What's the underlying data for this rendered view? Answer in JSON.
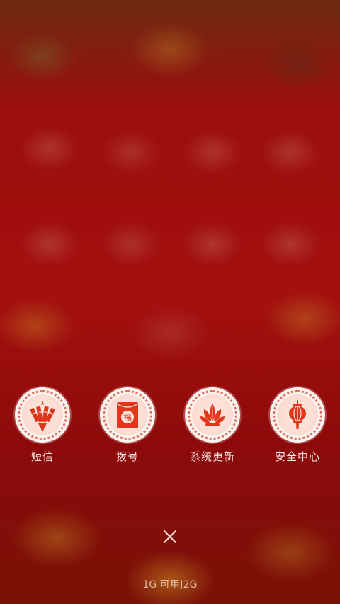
{
  "shortcuts": [
    {
      "label": "短信",
      "icon": "firecracker-icon"
    },
    {
      "label": "拨号",
      "icon": "red-envelope-fu-icon"
    },
    {
      "label": "系统更新",
      "icon": "lotus-icon"
    },
    {
      "label": "安全中心",
      "icon": "lantern-icon"
    }
  ],
  "envelope_char": "福",
  "close": {
    "icon": "close-icon"
  },
  "memory": {
    "available": "1G 可用",
    "total": "2G"
  },
  "colors": {
    "background": "#9c0e0e",
    "badge": "#fbf4ee",
    "badge_accent": "#e46d5e",
    "icon_red": "#e0361c",
    "label_text": "#ffe9e4"
  }
}
